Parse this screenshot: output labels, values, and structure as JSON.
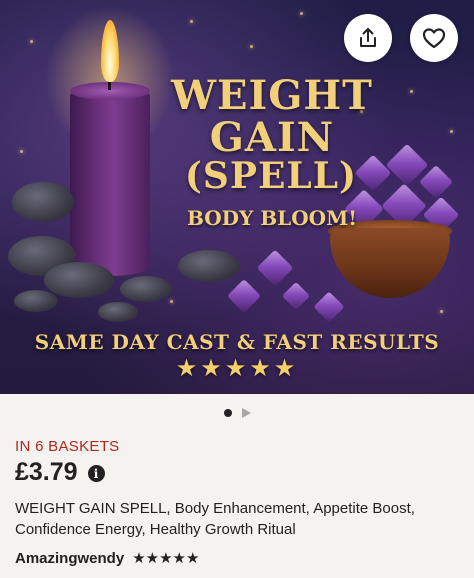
{
  "hero": {
    "title_line1": "WEIGHT",
    "title_line2": "GAIN",
    "title_line3": "(SPELL)",
    "subtitle": "BODY BLOOM!",
    "banner": "SAME DAY CAST & FAST RESULTS",
    "banner_stars": "★★★★★"
  },
  "actions": {
    "share_icon": "share-icon",
    "favorite_icon": "heart-icon"
  },
  "pager": {
    "current": 1,
    "total": 2
  },
  "listing": {
    "baskets_label": "IN 6 BASKETS",
    "price": "£3.79",
    "info_glyph": "i",
    "description": "WEIGHT GAIN SPELL, Body Enhancement, Appetite Boost, Confidence Energy, Healthy Growth Ritual",
    "seller": "Amazingwendy",
    "seller_rating_stars": "★★★★★",
    "seller_rating": 5
  },
  "colors": {
    "title_gold": "#f2cf7a",
    "baskets_red": "#b3261e",
    "page_bg": "#f5f3ef"
  }
}
